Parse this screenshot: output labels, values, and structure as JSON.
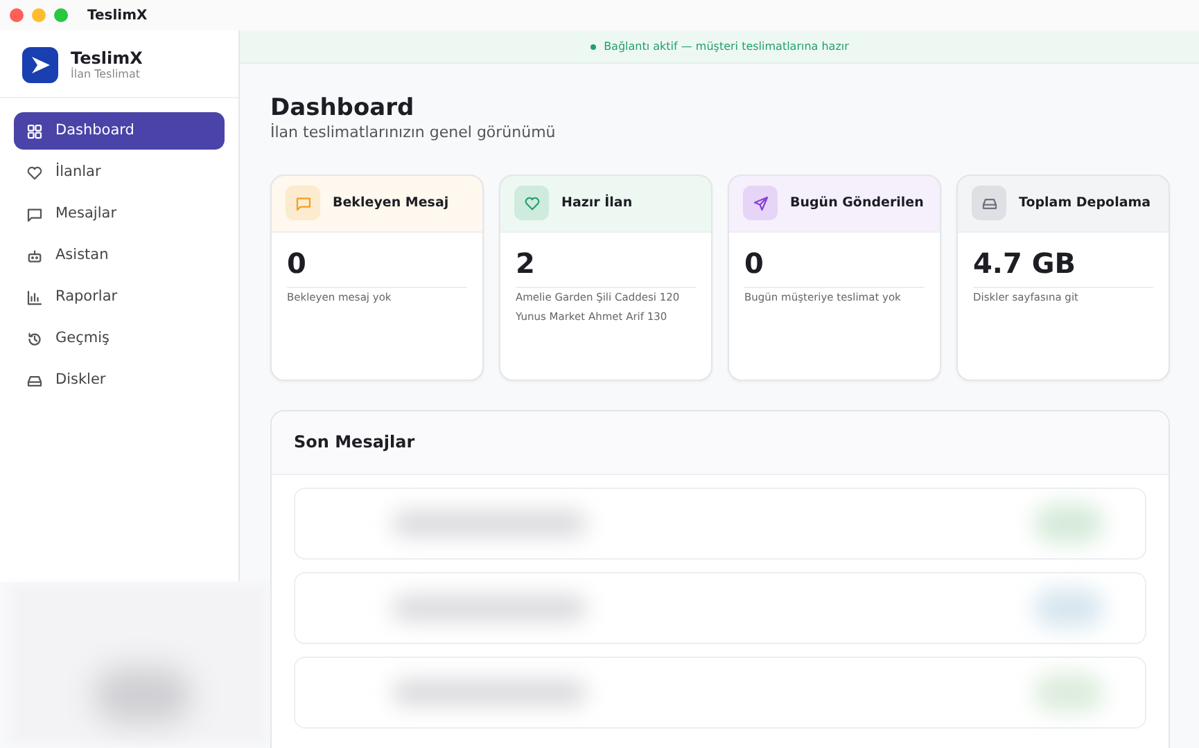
{
  "window": {
    "title": "TeslimX"
  },
  "brand": {
    "name": "TeslimX",
    "subtitle": "İlan Teslimat"
  },
  "sidebar": {
    "items": [
      {
        "label": "Dashboard",
        "kind": "grid",
        "selected": true
      },
      {
        "label": "İlanlar",
        "kind": "heart",
        "selected": false
      },
      {
        "label": "Mesajlar",
        "kind": "message",
        "selected": false
      },
      {
        "label": "Asistan",
        "kind": "bot",
        "selected": false
      },
      {
        "label": "Raporlar",
        "kind": "chart",
        "selected": false
      },
      {
        "label": "Geçmiş",
        "kind": "history",
        "selected": false
      },
      {
        "label": "Diskler",
        "kind": "drive",
        "selected": false
      }
    ]
  },
  "status_banner": {
    "text": "Bağlantı aktif — müşteri teslimatlarına hazır",
    "color": "#22a06b"
  },
  "page": {
    "title": "Dashboard",
    "subtitle": "İlan teslimatlarınızın genel görünümü"
  },
  "stat_cards": [
    {
      "title": "Bekleyen Mesaj",
      "kind": "message",
      "color": "#f0a020",
      "value": "0",
      "notes": [
        "Bekleyen mesaj yok"
      ]
    },
    {
      "title": "Hazır İlan",
      "kind": "heart",
      "color": "#22a06b",
      "value": "2",
      "notes": [
        "Amelie Garden Şili Caddesi 120",
        "Yunus Market Ahmet Arif 130"
      ]
    },
    {
      "title": "Bugün Gönderilen",
      "kind": "send",
      "color": "#8b3fd9",
      "value": "0",
      "notes": [
        "Bugün müşteriye teslimat yok"
      ]
    },
    {
      "title": "Toplam Depolama",
      "kind": "drive",
      "color": "#6b7280",
      "value": "4.7 GB",
      "notes": [
        "Diskler sayfasına git"
      ]
    }
  ],
  "recent_messages": {
    "title": "Son Mesajlar"
  }
}
